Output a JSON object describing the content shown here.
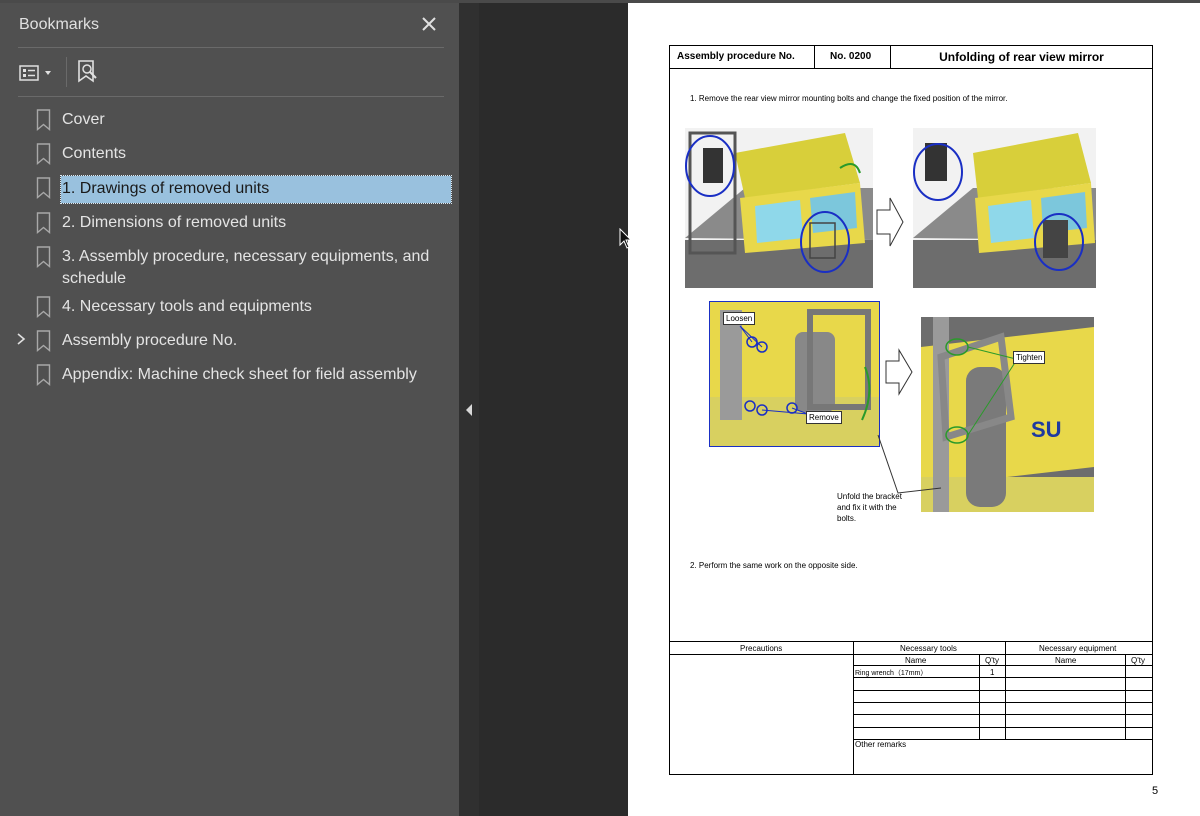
{
  "sidebar": {
    "title": "Bookmarks",
    "items": [
      {
        "label": "Cover"
      },
      {
        "label": "Contents"
      },
      {
        "label": "1. Drawings of removed units"
      },
      {
        "label": "2. Dimensions of removed units"
      },
      {
        "label": "3. Assembly procedure, necessary equipments, and"
      },
      {
        "label": "schedule"
      },
      {
        "label": "4. Necessary tools and equipments"
      },
      {
        "label": "Assembly procedure No."
      },
      {
        "label": "Appendix: Machine check sheet for field assembly"
      }
    ]
  },
  "document": {
    "header_label": "Assembly procedure No.",
    "header_no": "No. 0200",
    "header_title": "Unfolding of rear view mirror",
    "step1": "1. Remove the rear view mirror mounting bolts and change the fixed position of the mirror.",
    "step2": "2. Perform the same work on the opposite side.",
    "callouts": {
      "loosen": "Loosen",
      "remove": "Remove",
      "tighten": "Tighten",
      "unfold_1": "Unfold the bracket",
      "unfold_2": "and fix it with the",
      "unfold_3": "bolts."
    },
    "footer": {
      "precautions": "Precautions",
      "tools_header": "Necessary tools",
      "equip_header": "Necessary equipment",
      "name": "Name",
      "qty": "Q'ty",
      "tool_name": "Ring wrench（17mm）",
      "tool_qty": "1",
      "other_remarks": "Other remarks"
    },
    "page_number": "5"
  },
  "colors": {
    "sidebar_bg": "#505050",
    "selection": "#99c1de",
    "machine_yellow": "#e8d84a",
    "circle_blue": "#1a2fc4"
  }
}
